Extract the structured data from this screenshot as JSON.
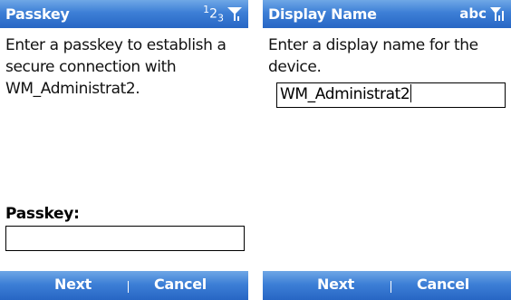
{
  "screens": [
    {
      "title": "Passkey",
      "input_mode": {
        "base": "1",
        "sup": "2",
        "sub": "3"
      },
      "message": "Enter a passkey to establish a secure connection with WM_Administrat2.",
      "field_label": "Passkey:",
      "field_value": "",
      "softkeys": {
        "left": "Next",
        "right": "Cancel"
      }
    },
    {
      "title": "Display Name",
      "input_mode": {
        "text": "abc"
      },
      "message": "Enter a display name for the device.",
      "field_value": "WM_Administrat2",
      "softkeys": {
        "left": "Next",
        "right": "Cancel"
      }
    }
  ],
  "icons": {
    "signal": "signal-strength-icon"
  },
  "colors": {
    "bar_top": "#6fa7e6",
    "bar_mid": "#3d7fd6",
    "bar_bottom": "#2766c4",
    "bar_text": "#ffffff",
    "content_text": "#111111"
  }
}
